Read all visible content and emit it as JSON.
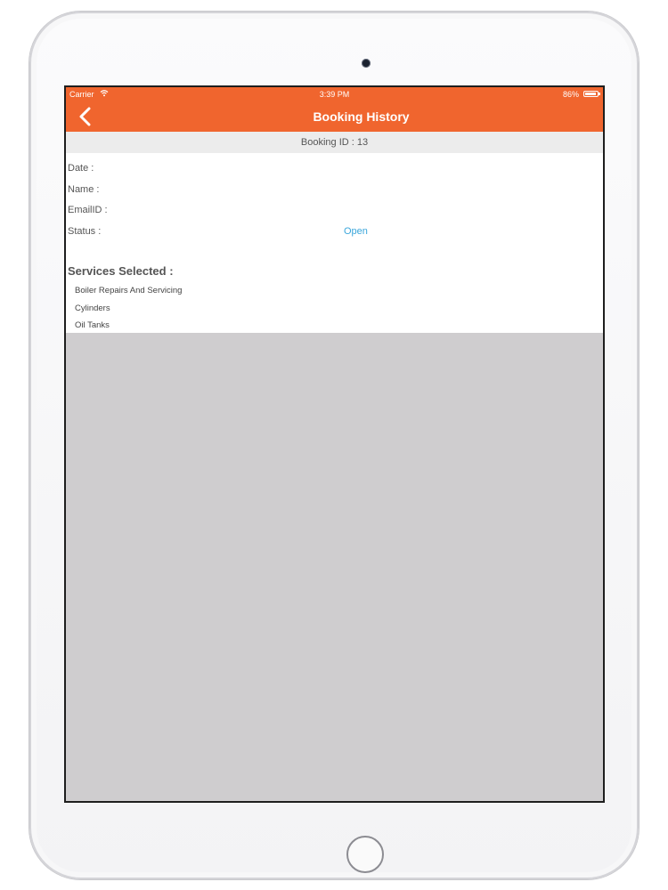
{
  "status_bar": {
    "carrier": "Carrier",
    "time": "3:39 PM",
    "battery": "86%"
  },
  "nav": {
    "title": "Booking History",
    "back_icon": "chevron-left-icon",
    "color": "#f0652e"
  },
  "booking": {
    "id_label": "Booking ID : 13",
    "date_label": "Date :",
    "name_label": "Name :",
    "email_label": "EmailID :",
    "status_label": "Status :",
    "status_value": "Open",
    "status_color": "#3aa6db"
  },
  "services": {
    "heading": "Services Selected :",
    "items": [
      "Boiler Repairs And Servicing",
      "Cylinders",
      "Oil Tanks"
    ]
  }
}
